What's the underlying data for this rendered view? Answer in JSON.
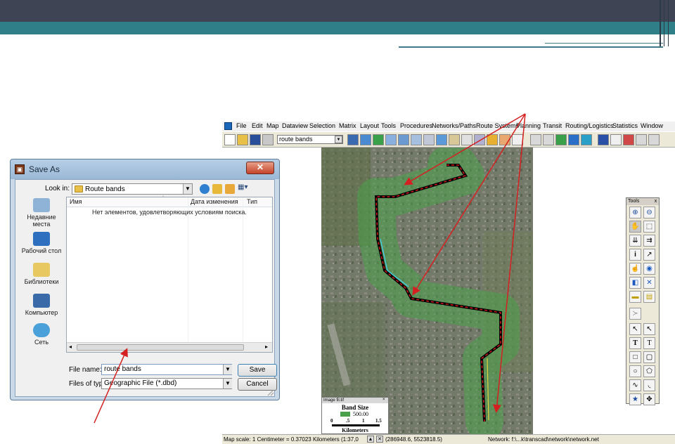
{
  "save_dialog": {
    "title": "Save As",
    "close_glyph": "✕",
    "look_in_label": "Look in:",
    "look_in_value": "Route bands",
    "places": [
      "Недавние места",
      "Рабочий стол",
      "Библиотеки",
      "Компьютер",
      "Сеть"
    ],
    "columns": {
      "name": "Имя",
      "date": "Дата изменения",
      "type": "Тип"
    },
    "empty_message": "Нет элементов, удовлетворяющих условиям поиска.",
    "file_name_label": "File name:",
    "file_name_value": "route bands",
    "file_type_label": "Files of type:",
    "file_type_value": "Geographic File (*.dbd)",
    "save_label": "Save",
    "cancel_label": "Cancel"
  },
  "transcad": {
    "menu": [
      "File",
      "Edit",
      "Map",
      "Dataview",
      "Selection",
      "Matrix",
      "Layout",
      "Tools",
      "Procedures",
      "Networks/Paths",
      "Route Systems",
      "Planning",
      "Transit",
      "Routing/Logistics",
      "Statistics",
      "Window"
    ],
    "layer_value": "route bands",
    "legend": {
      "window_title": "Image fil.tif",
      "heading": "Band Size",
      "value": "500.00",
      "ticks": [
        "0",
        ".5",
        "1",
        "1.5"
      ],
      "units": "Kilometers"
    },
    "status": {
      "scale": "Map scale: 1 Centimeter = 0.37023 Kilometers (1:37,0",
      "coords": "(286948.6, 5523818.5)",
      "network": "Network: f:\\...k\\transcad\\network\\network.net"
    }
  },
  "tools_palette": {
    "title": "Tools",
    "close_glyph": "x"
  },
  "colors": {
    "header_dark": "#3f4455",
    "header_teal": "#2e7f87",
    "band_green": "#4aa04a",
    "route_red": "#d01818",
    "annotation_red": "#d42020"
  }
}
